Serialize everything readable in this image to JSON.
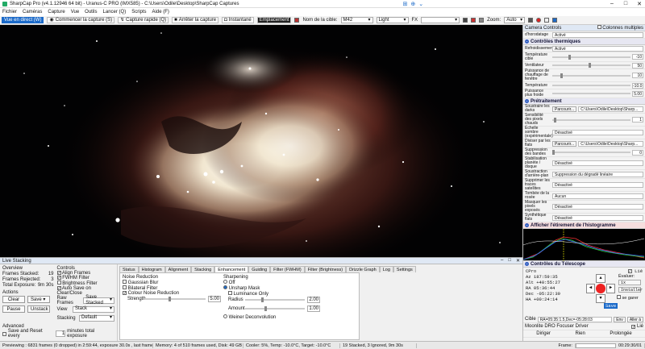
{
  "titlebar": {
    "title": "SharpCap Pro (v4.1.12946 64 bit) - Uranus-C PRO (IMX585) - C:\\Users\\Odile\\Desktop\\SharpCap Captures"
  },
  "menu": [
    "Fichier",
    "Caméras",
    "Capture",
    "Vue",
    "Outils",
    "Lancer (Q)",
    "Scripts",
    "Aide (F)"
  ],
  "toolbar": {
    "live_view": "Vue en direct (W)",
    "start_capture": "Commencer la capture (S)",
    "quick_capture": "Capture rapide (Q)",
    "stop_capture": "Arrêter la capture",
    "snapshot": "Instantané",
    "framing": "Emplacement",
    "target_label": "Nom de la cible:",
    "target_value": "M42",
    "profile_value": "Light",
    "fx_label": "FX",
    "zoom_label": "Zoom:",
    "zoom_value": "Auto"
  },
  "rightpanel": {
    "header": "Camera Controls",
    "multi_col": "Colonnes multiples",
    "top_item": "d'horodatage",
    "top_item2": "Activé",
    "thermal_title": "Contrôles thermiques",
    "cooling_label": "Refroidissement",
    "cooling_value": "Activé",
    "target_temp_label": "Température cible",
    "target_temp_value": "-10",
    "fan_label": "Ventilateur",
    "fan_value": "50",
    "heater_label": "Puissance de chauffage de fenêtre",
    "heater_value": "10",
    "temp_label": "Température",
    "temp_value": "-10.0",
    "power_label": "Puissance plus froide",
    "power_value": "5.00",
    "preproc_title": "Prétraitement",
    "darks_label": "Soustraire les darks",
    "darks_btn": "Parcourir...",
    "darks_path": "C:\\Users\\Odile\\Desktop\\Sharp...",
    "hot_label": "Sensibilité des pixels chauds",
    "hot_value": "1",
    "dark_scale_label": "Échelle sombre (expérimentale)",
    "dark_scale_value": "Désactivé",
    "flat_label": "Diviser par les flats",
    "flat_btn": "Parcourir...",
    "flat_path": "C:\\Users\\Odile\\Desktop\\Sharp...",
    "banding_label": "Suppression des bandes",
    "banding_value": "0",
    "planet_label": "Stabilisation planète / disque",
    "planet_value": "Désactivé",
    "bg_label": "Soustraction d'arrière-plan",
    "bg_value": "Suppression du dégradé linéaire",
    "sat_label": "Supprimer les traces satellites",
    "sat_value": "Désactivé",
    "drop_label": "Tombée de la rosée",
    "drop_value": "Aucun",
    "mask_label": "Masquer les pixels exposés",
    "mask_value": "Désactivé",
    "synth_label": "Synthétique flats",
    "synth_value": "Désactivé",
    "hist_title": "Afficher l'étirement de l'histogramme",
    "scope_title": "Contrôles du Télescope",
    "scope_name": "CPro",
    "scope_live": "Lié",
    "az_label": "Az",
    "az_value": "187:59:35",
    "alt_label": "Alt",
    "alt_value": "+40:55:27",
    "ra_label": "RA",
    "ra_value": "05:36:44",
    "dec_label": "Dec",
    "dec_value": "-05:22:39",
    "ha_label": "HA",
    "ha_value": "+00:24:14",
    "eval_label": "Évaluer:",
    "eval_value": "1x",
    "install_btn": "Installer",
    "park_label": "se garer",
    "save_btn": "Save",
    "target_coord_label": "Cible",
    "target_coord_value": "RA=05:35:1.5,Dec=-05:28:03",
    "goto_btn": "Env",
    "goto_btn2": "Aller à",
    "focuser_label": "Moonlite DRO Focuser Driver",
    "focuser_live": "Lié",
    "bottom_cols": [
      "Diriger",
      "Rien",
      "Prolongée"
    ]
  },
  "bottom": {
    "header": "Live Stacking",
    "overview_label": "Overview",
    "frames_stacked_label": "Frames Stacked:",
    "frames_stacked_value": "19",
    "frames_rejected_label": "Frames Rejected:",
    "frames_rejected_value": "3",
    "total_exposure_label": "Total Exposure:",
    "total_exposure_value": "9m 30s",
    "actions_label": "Actions",
    "clear_btn": "Clear",
    "save_btn": "Save",
    "pause_btn": "Pause",
    "unstack_btn": "Unstack",
    "advanced_label": "Advanced",
    "save_reset_label": "Save and Reset every",
    "save_reset_value": "1",
    "save_reset_unit": "minutes total exposure",
    "controls_label": "Controls",
    "align_label": "Align Frames",
    "fwhm_label": "FWHM Filter",
    "brightness_label": "Brightness Filter",
    "autosave_label": "Auto Save on Clear/Close",
    "raw_label": "Raw Frames",
    "raw_value": "Save Stacked",
    "view_label": "View",
    "view_value": "Stack",
    "stacking_label": "Stacking",
    "stacking_value": "Default",
    "tabs": [
      "Status",
      "Histogram",
      "Alignment",
      "Stacking",
      "Enhancement",
      "Guiding",
      "Filter (FWHM)",
      "Filter (Brightness)",
      "Drizzle Graph",
      "Log",
      "Settings"
    ],
    "nr_label": "Noise Reduction",
    "gauss_label": "Gaussian Blur",
    "bilat_label": "Bilateral Filter",
    "colour_label": "Colour Noise Reduction",
    "strength_label": "Strength",
    "strength_value": "5.00",
    "sharp_label": "Sharpening",
    "off_label": "Off",
    "unsharp_label": "Unsharp Mask",
    "lum_label": "Luminance Only",
    "radius_label": "Radius",
    "radius_value": "2.00",
    "amount_label": "Amount",
    "amount_value": "1.00",
    "wiener_label": "Weiner Deconvolution"
  },
  "status": {
    "preview": "Previewing : 6831 frames (0 dropped) in 2:59:44, exposure 30.0s , last frame 30.0s",
    "memory": "Memory: 4 of 510 frames used, Disk: 49 GB free",
    "cooler": "Cooler: 5%, Temp: -10.0°C, Target: -10.0°C",
    "stack": "19 Stacked, 3 Ignored, 9m 30s",
    "frame_label": "Frame:",
    "time": "00:29:30/01"
  }
}
